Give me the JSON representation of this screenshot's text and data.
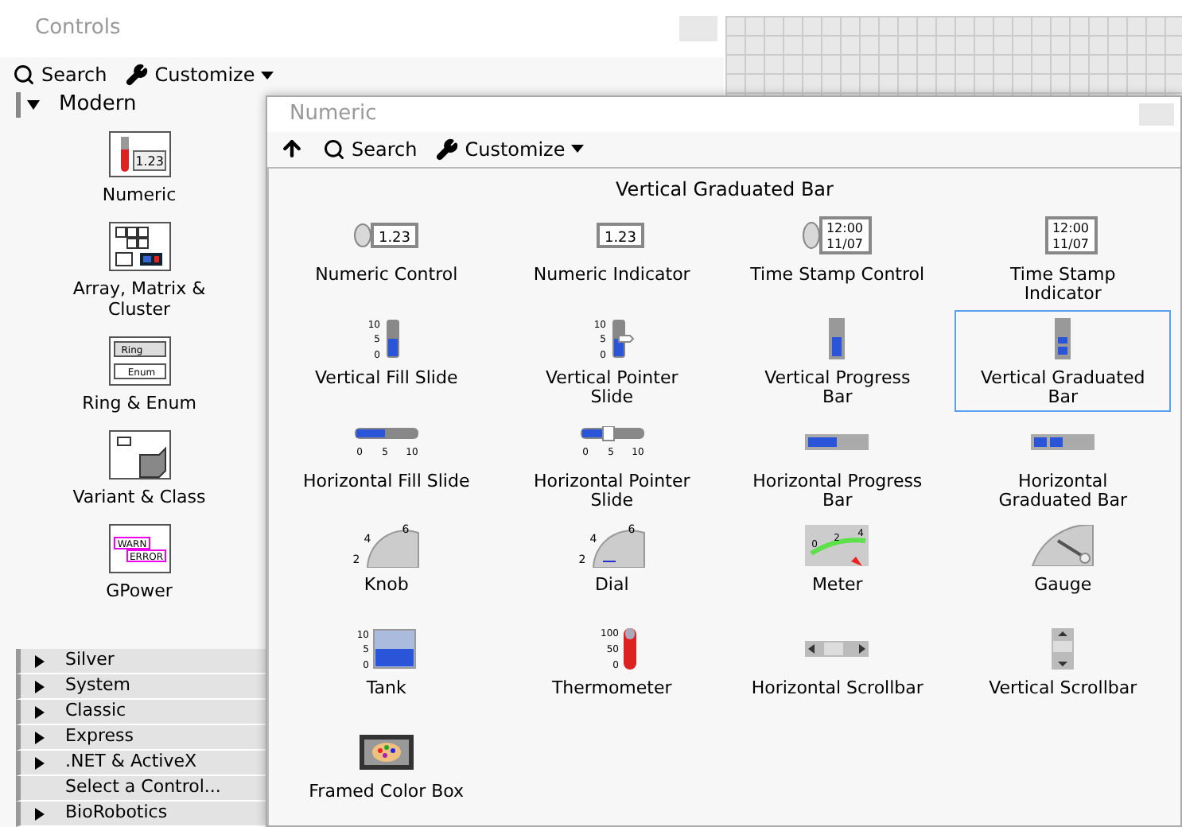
{
  "controls_palette": {
    "title": "Controls",
    "toolbar": {
      "search": "Search",
      "customize": "Customize"
    },
    "modern": {
      "label": "Modern",
      "expanded": true,
      "items": [
        {
          "label": "Numeric",
          "kind": "numeric",
          "icon_text": [
            "1.23"
          ]
        },
        {
          "label": "Array, Matrix & Cluster",
          "kind": "array"
        },
        {
          "label": "Ring & Enum",
          "kind": "ring",
          "icon_text": [
            "Ring",
            "Enum"
          ]
        },
        {
          "label": "Variant & Class",
          "kind": "variant"
        },
        {
          "label": "GPower",
          "kind": "gpower",
          "icon_text": [
            "WARN",
            "ERROR"
          ]
        }
      ]
    },
    "categories": [
      {
        "label": "Silver",
        "kind": "category",
        "expanded": false
      },
      {
        "label": "System",
        "kind": "category",
        "expanded": false
      },
      {
        "label": "Classic",
        "kind": "category",
        "expanded": false
      },
      {
        "label": "Express",
        "kind": "category",
        "expanded": false
      },
      {
        "label": ".NET & ActiveX",
        "kind": "category",
        "expanded": false
      },
      {
        "label": "Select a Control...",
        "kind": "action"
      },
      {
        "label": "BioRobotics",
        "kind": "category",
        "expanded": false
      }
    ]
  },
  "numeric_palette": {
    "title": "Numeric",
    "toolbar": {
      "search": "Search",
      "customize": "Customize"
    },
    "hover_label": "Vertical Graduated Bar",
    "items": [
      {
        "label": "Numeric Control",
        "kind": "numeric-control",
        "selected": false,
        "icon_text": [
          "1.23"
        ]
      },
      {
        "label": "Numeric Indicator",
        "kind": "numeric-indicator",
        "selected": false,
        "icon_text": [
          "1.23"
        ]
      },
      {
        "label": "Time Stamp Control",
        "kind": "timestamp-control",
        "selected": false,
        "icon_text": [
          "12:00",
          "11/07"
        ]
      },
      {
        "label": "Time Stamp Indicator",
        "kind": "timestamp-indicator",
        "selected": false,
        "icon_text": [
          "12:00",
          "11/07"
        ]
      },
      {
        "label": "Vertical Fill Slide",
        "kind": "vfill",
        "selected": false,
        "icon_text": [
          "10",
          "5",
          "0"
        ]
      },
      {
        "label": "Vertical Pointer Slide",
        "kind": "vpointer",
        "selected": false,
        "icon_text": [
          "10",
          "5",
          "0"
        ]
      },
      {
        "label": "Vertical Progress Bar",
        "kind": "vprogress",
        "selected": false
      },
      {
        "label": "Vertical Graduated Bar",
        "kind": "vgraduated",
        "selected": true
      },
      {
        "label": "Horizontal Fill Slide",
        "kind": "hfill",
        "selected": false,
        "icon_text": [
          "0",
          "5",
          "10"
        ]
      },
      {
        "label": "Horizontal Pointer Slide",
        "kind": "hpointer",
        "selected": false,
        "icon_text": [
          "0",
          "5",
          "10"
        ]
      },
      {
        "label": "Horizontal Progress Bar",
        "kind": "hprogress",
        "selected": false
      },
      {
        "label": "Horizontal Graduated Bar",
        "kind": "hgraduated",
        "selected": false
      },
      {
        "label": "Knob",
        "kind": "knob",
        "selected": false,
        "icon_text": [
          "2",
          "4",
          "6"
        ]
      },
      {
        "label": "Dial",
        "kind": "dial",
        "selected": false,
        "icon_text": [
          "2",
          "4",
          "6"
        ]
      },
      {
        "label": "Meter",
        "kind": "meter",
        "selected": false,
        "icon_text": [
          "0",
          "2",
          "4"
        ]
      },
      {
        "label": "Gauge",
        "kind": "gauge",
        "selected": false
      },
      {
        "label": "Tank",
        "kind": "tank",
        "selected": false,
        "icon_text": [
          "10",
          "5",
          "0"
        ]
      },
      {
        "label": "Thermometer",
        "kind": "thermometer",
        "selected": false,
        "icon_text": [
          "100",
          "50",
          "0"
        ]
      },
      {
        "label": "Horizontal Scrollbar",
        "kind": "hscroll",
        "selected": false
      },
      {
        "label": "Vertical Scrollbar",
        "kind": "vscroll",
        "selected": false
      },
      {
        "label": "Framed Color Box",
        "kind": "colorbox",
        "selected": false
      }
    ]
  }
}
